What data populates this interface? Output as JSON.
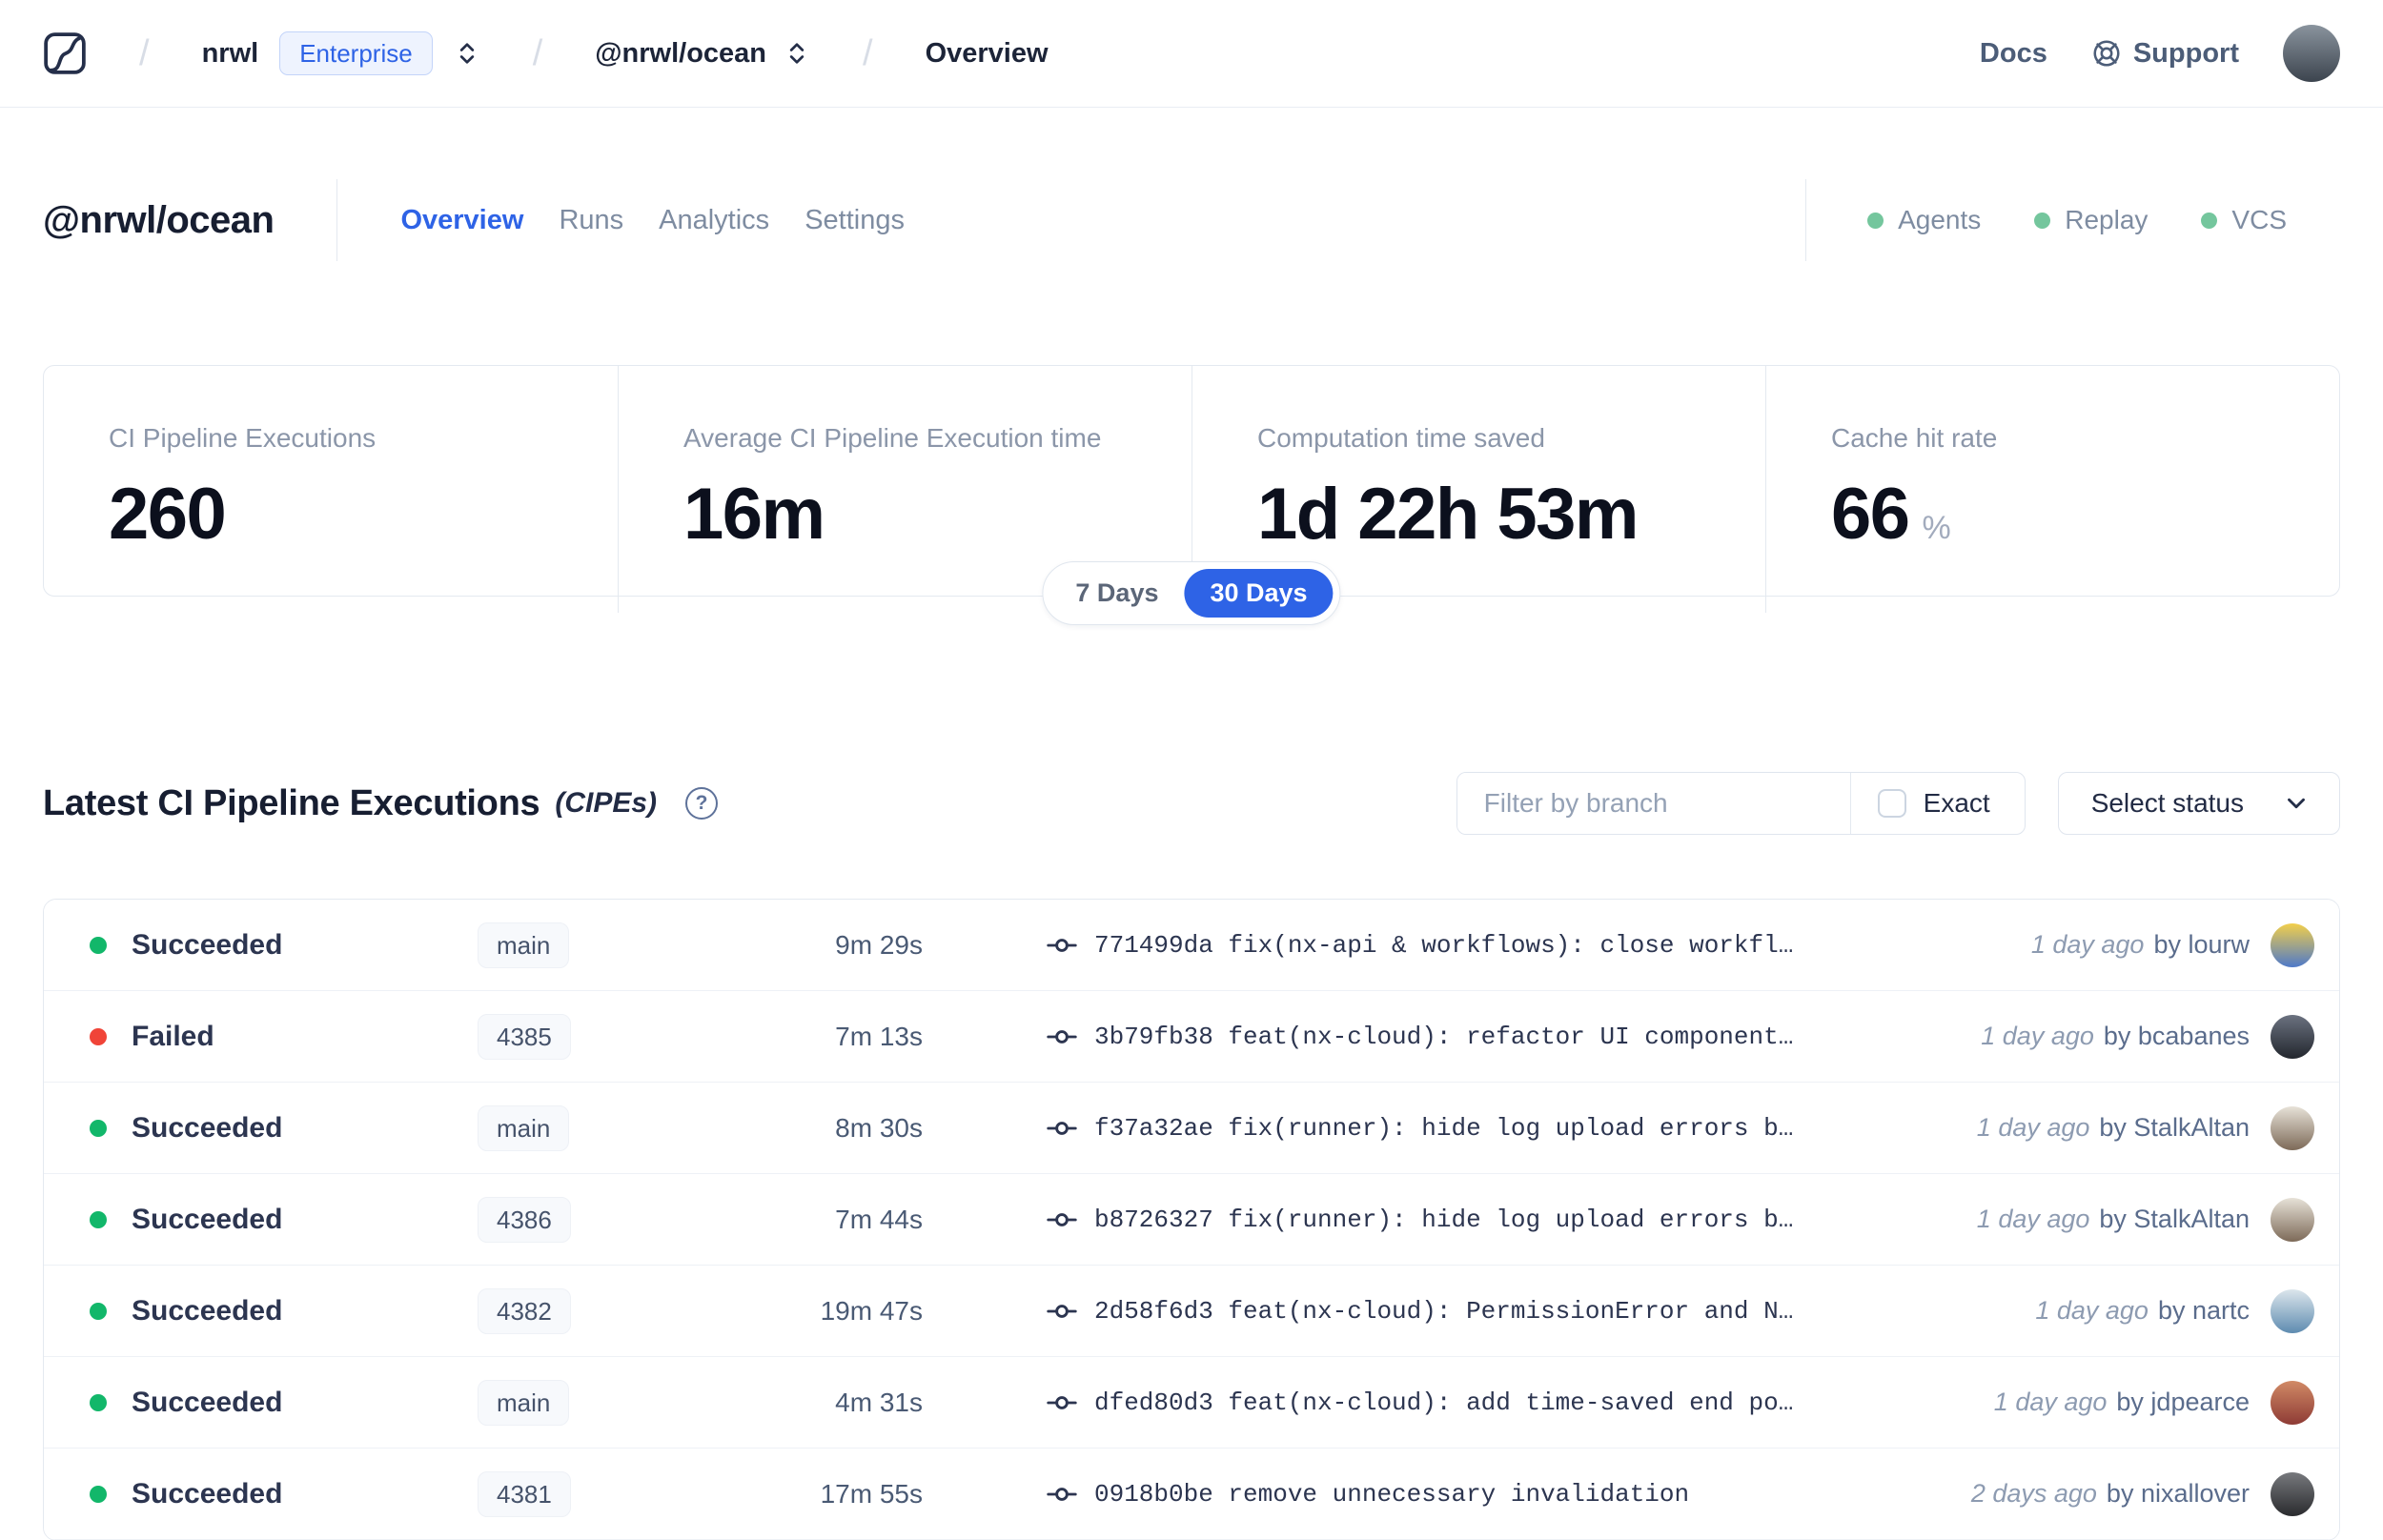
{
  "colors": {
    "accent": "#2e63e6",
    "success_dot": "#12b76a",
    "failed_dot": "#f04438",
    "service_dot": "#74c69d",
    "navbar_avatar": [
      "#8a949e",
      "#3c444e"
    ]
  },
  "navbar": {
    "breadcrumb": {
      "org": "nrwl",
      "org_badge": "Enterprise",
      "workspace": "@nrwl/ocean",
      "page": "Overview"
    },
    "docs_label": "Docs",
    "support_label": "Support"
  },
  "workspace_header": {
    "title": "@nrwl/ocean",
    "active_tab": "Overview",
    "tabs": [
      {
        "label": "Overview"
      },
      {
        "label": "Runs"
      },
      {
        "label": "Analytics"
      },
      {
        "label": "Settings"
      }
    ],
    "services": [
      {
        "label": "Agents"
      },
      {
        "label": "Replay"
      },
      {
        "label": "VCS"
      }
    ]
  },
  "stats": {
    "cards": [
      {
        "label": "CI Pipeline Executions",
        "value": "260",
        "unit": ""
      },
      {
        "label": "Average CI Pipeline Execution time",
        "value": "16m",
        "unit": ""
      },
      {
        "label": "Computation time saved",
        "value": "1d 22h 53m",
        "unit": ""
      },
      {
        "label": "Cache hit rate",
        "value": "66",
        "unit": "%"
      }
    ],
    "range_toggle": {
      "options": [
        "7 Days",
        "30 Days"
      ],
      "selected": "30 Days"
    }
  },
  "cipes": {
    "title": "Latest CI Pipeline Executions",
    "title_suffix": "(CIPEs)",
    "filter_placeholder": "Filter by branch",
    "exact_label": "Exact",
    "exact_checked": false,
    "status_select_label": "Select status",
    "rows": [
      {
        "status": "Succeeded",
        "status_color": "success",
        "branch": "main",
        "duration": "9m 29s",
        "commit": "771499da fix(nx-api & workflows): close workfl…",
        "time": "1 day ago",
        "author": "by lourw",
        "avatar": [
          "#f2cf4b",
          "#4e79c9"
        ]
      },
      {
        "status": "Failed",
        "status_color": "failed",
        "branch": "4385",
        "duration": "7m 13s",
        "commit": "3b79fb38 feat(nx-cloud): refactor UI component…",
        "time": "1 day ago",
        "author": "by bcabanes",
        "avatar": [
          "#6b7280",
          "#23272e"
        ]
      },
      {
        "status": "Succeeded",
        "status_color": "success",
        "branch": "main",
        "duration": "8m 30s",
        "commit": "f37a32ae fix(runner): hide log upload errors b…",
        "time": "1 day ago",
        "author": "by StalkAltan",
        "avatar": [
          "#e7e2d8",
          "#7d6a58"
        ]
      },
      {
        "status": "Succeeded",
        "status_color": "success",
        "branch": "4386",
        "duration": "7m 44s",
        "commit": "b8726327 fix(runner): hide log upload errors b…",
        "time": "1 day ago",
        "author": "by StalkAltan",
        "avatar": [
          "#e7e2d8",
          "#7d6a58"
        ]
      },
      {
        "status": "Succeeded",
        "status_color": "success",
        "branch": "4382",
        "duration": "19m 47s",
        "commit": "2d58f6d3 feat(nx-cloud): PermissionError and N…",
        "time": "1 day ago",
        "author": "by nartc",
        "avatar": [
          "#dce6ec",
          "#5e8bb0"
        ]
      },
      {
        "status": "Succeeded",
        "status_color": "success",
        "branch": "main",
        "duration": "4m 31s",
        "commit": "dfed80d3 feat(nx-cloud): add time-saved end po…",
        "time": "1 day ago",
        "author": "by jdpearce",
        "avatar": [
          "#d18a66",
          "#8e3b35"
        ]
      },
      {
        "status": "Succeeded",
        "status_color": "success",
        "branch": "4381",
        "duration": "17m 55s",
        "commit": "0918b0be remove unnecessary invalidation",
        "time": "2 days ago",
        "author": "by nixallover",
        "avatar": [
          "#77797d",
          "#2a2b2e"
        ]
      }
    ]
  }
}
